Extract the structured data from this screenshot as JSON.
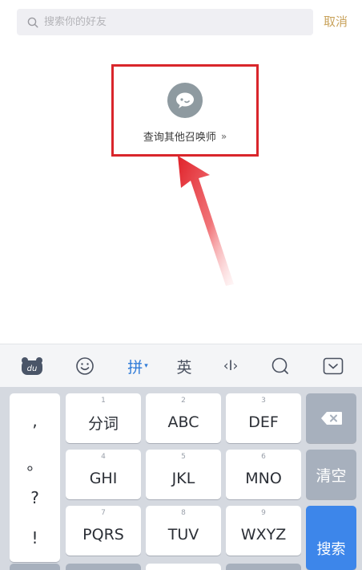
{
  "search": {
    "placeholder": "搜索你的好友",
    "cancel_label": "取消"
  },
  "query": {
    "label": "查询其他召唤师",
    "chevron": "»",
    "icon": "chat-bubble-icon"
  },
  "toolbar": {
    "items": [
      {
        "name": "du-logo-icon",
        "text": ""
      },
      {
        "name": "emoji-icon",
        "text": ""
      },
      {
        "name": "pinyin-mode",
        "text": "拼"
      },
      {
        "name": "english-mode",
        "text": "英"
      },
      {
        "name": "cursor-icon",
        "text": "‹I›"
      },
      {
        "name": "search-icon",
        "text": ""
      },
      {
        "name": "collapse-keyboard-icon",
        "text": ""
      }
    ],
    "active_color": "#2f7bd8"
  },
  "keyboard": {
    "punctuation": [
      ",",
      "。",
      "?",
      "!"
    ],
    "keys": [
      {
        "num": "1",
        "label": "分词"
      },
      {
        "num": "2",
        "label": "ABC"
      },
      {
        "num": "3",
        "label": "DEF"
      },
      {
        "num": "4",
        "label": "GHI"
      },
      {
        "num": "5",
        "label": "JKL"
      },
      {
        "num": "6",
        "label": "MNO"
      },
      {
        "num": "7",
        "label": "PQRS"
      },
      {
        "num": "8",
        "label": "TUV"
      },
      {
        "num": "9",
        "label": "WXYZ"
      }
    ],
    "clear_label": "清空",
    "search_label": "搜索",
    "accent": "#3d86ea"
  }
}
